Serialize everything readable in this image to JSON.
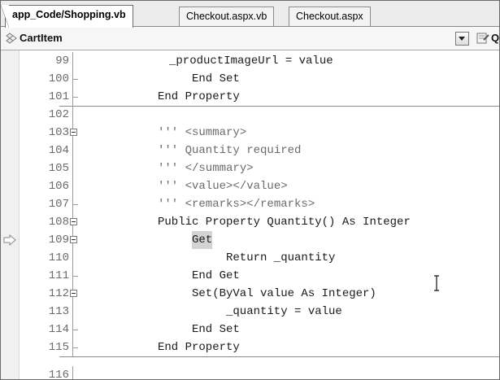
{
  "tabs": [
    {
      "label": "app_Code/Shopping.vb",
      "active": true
    },
    {
      "label": "Checkout.aspx.vb",
      "active": false
    },
    {
      "label": "Checkout.aspx",
      "active": false
    }
  ],
  "navbar": {
    "class_icon": "class-icon",
    "class_name": "CartItem",
    "member_icon": "property-icon",
    "member_name": "Q"
  },
  "editor": {
    "lines": [
      {
        "num": "99",
        "text": "_productImageUrl = value",
        "indent": 24,
        "type": "code"
      },
      {
        "num": "100",
        "text": "End Set",
        "indent": 16,
        "type": "code"
      },
      {
        "num": "101",
        "text": "End Property",
        "indent": 8,
        "type": "code"
      },
      {
        "num": "102",
        "text": "",
        "indent": 0,
        "type": "code"
      },
      {
        "num": "103",
        "text": "''' <summary>",
        "indent": 8,
        "type": "comment"
      },
      {
        "num": "104",
        "text": "''' Quantity required",
        "indent": 8,
        "type": "comment"
      },
      {
        "num": "105",
        "text": "''' </summary>",
        "indent": 8,
        "type": "comment"
      },
      {
        "num": "106",
        "text": "''' <value></value>",
        "indent": 8,
        "type": "comment"
      },
      {
        "num": "107",
        "text": "''' <remarks></remarks>",
        "indent": 8,
        "type": "comment"
      },
      {
        "num": "108",
        "text": "Public Property Quantity() As Integer",
        "indent": 8,
        "type": "code"
      },
      {
        "num": "109",
        "text": "Get",
        "indent": 16,
        "type": "code"
      },
      {
        "num": "110",
        "text": "Return _quantity",
        "indent": 24,
        "type": "code"
      },
      {
        "num": "111",
        "text": "End Get",
        "indent": 16,
        "type": "code"
      },
      {
        "num": "112",
        "text": "Set(ByVal value As Integer)",
        "indent": 16,
        "type": "code"
      },
      {
        "num": "113",
        "text": "_quantity = value",
        "indent": 24,
        "type": "code"
      },
      {
        "num": "114",
        "text": "End Set",
        "indent": 16,
        "type": "code"
      },
      {
        "num": "115",
        "text": "End Property",
        "indent": 8,
        "type": "code"
      },
      {
        "num": "116",
        "text": "",
        "indent": 0,
        "type": "code"
      }
    ],
    "current_line": "109",
    "highlighted_token": "Get",
    "mouse_cursor": "text-cursor-icon"
  },
  "colors": {
    "comment": "#6b6b6b",
    "code": "#1a1a1a",
    "line_number": "#6a6a6a",
    "highlight": "#d4d4d4"
  }
}
